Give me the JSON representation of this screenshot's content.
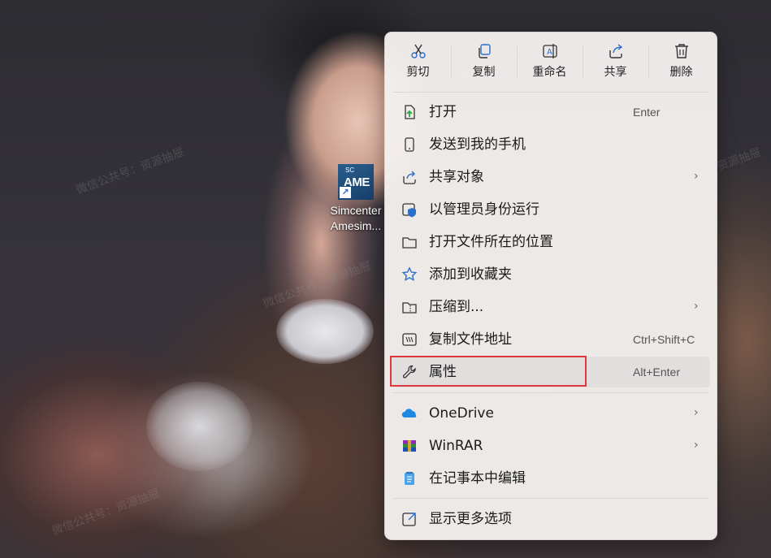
{
  "desktop": {
    "icon_badge_top": "SC",
    "icon_badge_main": "AME",
    "icon_label_line1": "Simcenter",
    "icon_label_line2": "Amesim..."
  },
  "toolbar": {
    "cut": "剪切",
    "copy": "复制",
    "rename": "重命名",
    "share": "共享",
    "delete": "删除"
  },
  "menu_items": [
    {
      "label": "打开",
      "shortcut": "Enter",
      "icon": "open-icon"
    },
    {
      "label": "发送到我的手机",
      "icon": "phone-icon"
    },
    {
      "label": "共享对象",
      "icon": "share-icon",
      "submenu": true
    },
    {
      "label": "以管理员身份运行",
      "icon": "shield-icon"
    },
    {
      "label": "打开文件所在的位置",
      "icon": "folder-icon"
    },
    {
      "label": "添加到收藏夹",
      "icon": "star-icon"
    },
    {
      "label": "压缩到...",
      "icon": "zip-folder-icon",
      "submenu": true
    },
    {
      "label": "复制文件地址",
      "shortcut": "Ctrl+Shift+C",
      "icon": "copy-path-icon"
    },
    {
      "label": "属性",
      "shortcut": "Alt+Enter",
      "icon": "wrench-icon",
      "highlighted": true
    },
    {
      "label": "OneDrive",
      "icon": "onedrive-icon",
      "submenu": true
    },
    {
      "label": "WinRAR",
      "icon": "winrar-icon",
      "submenu": true
    },
    {
      "label": "在记事本中编辑",
      "icon": "notepad-icon"
    },
    {
      "label": "显示更多选项",
      "icon": "more-options-icon"
    }
  ],
  "watermark": "微信公共号：资源抽屉",
  "colors": {
    "highlight_border": "#e0383f",
    "accent": "#1e6bd1"
  }
}
